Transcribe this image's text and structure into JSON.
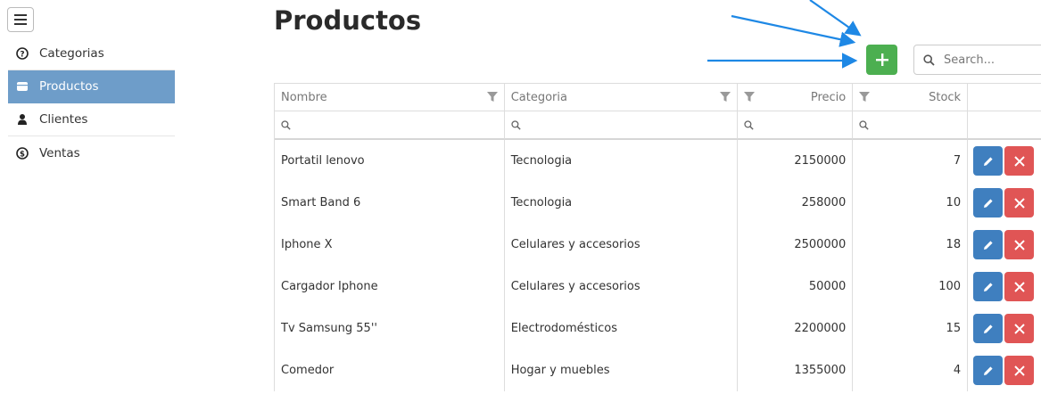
{
  "sidebar": {
    "items": [
      {
        "label": "Categorias",
        "icon": "question-circle-icon",
        "active": false
      },
      {
        "label": "Productos",
        "icon": "box-icon",
        "active": true
      },
      {
        "label": "Clientes",
        "icon": "user-icon",
        "active": false
      },
      {
        "label": "Ventas",
        "icon": "dollar-circle-icon",
        "active": false
      }
    ]
  },
  "page": {
    "title": "Productos"
  },
  "toolbar": {
    "search_placeholder": "Search..."
  },
  "table": {
    "columns": [
      "Nombre",
      "Categoria",
      "Precio",
      "Stock"
    ],
    "rows": [
      {
        "nombre": "Portatil lenovo",
        "categoria": "Tecnologia",
        "precio": "2150000",
        "stock": "7"
      },
      {
        "nombre": "Smart Band 6",
        "categoria": "Tecnologia",
        "precio": "258000",
        "stock": "10"
      },
      {
        "nombre": "Iphone X",
        "categoria": "Celulares y accesorios",
        "precio": "2500000",
        "stock": "18"
      },
      {
        "nombre": "Cargador Iphone",
        "categoria": "Celulares y accesorios",
        "precio": "50000",
        "stock": "100"
      },
      {
        "nombre": "Tv Samsung 55''",
        "categoria": "Electrodomésticos",
        "precio": "2200000",
        "stock": "15"
      },
      {
        "nombre": "Comedor",
        "categoria": "Hogar y muebles",
        "precio": "1355000",
        "stock": "4"
      }
    ]
  },
  "colors": {
    "active_sidebar": "#6e9dc9",
    "add_button": "#4caf50",
    "edit_button": "#3f7fbf",
    "delete_button": "#e05555",
    "arrow": "#1e88e5"
  }
}
